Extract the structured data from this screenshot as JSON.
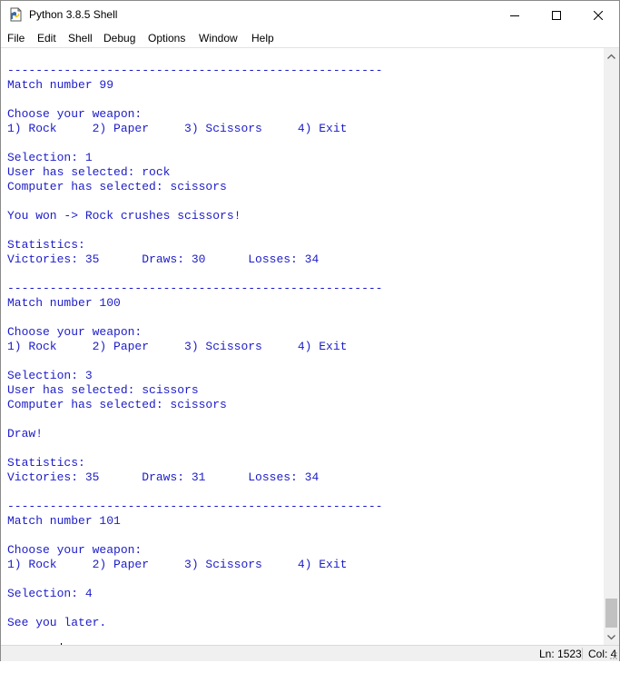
{
  "window": {
    "title": "Python 3.8.5 Shell"
  },
  "menu": [
    "File",
    "Edit",
    "Shell",
    "Debug",
    "Options",
    "Window",
    "Help"
  ],
  "shell": {
    "lines": [
      "-----------------------------------------------------",
      "Match number 99",
      "",
      "Choose your weapon:",
      "1) Rock     2) Paper     3) Scissors     4) Exit",
      "",
      "Selection: 1",
      "User has selected: rock",
      "Computer has selected: scissors",
      "",
      "You won -> Rock crushes scissors!",
      "",
      "Statistics:",
      "Victories: 35      Draws: 30      Losses: 34",
      "",
      "-----------------------------------------------------",
      "Match number 100",
      "",
      "Choose your weapon:",
      "1) Rock     2) Paper     3) Scissors     4) Exit",
      "",
      "Selection: 3",
      "User has selected: scissors",
      "Computer has selected: scissors",
      "",
      "Draw!",
      "",
      "Statistics:",
      "Victories: 35      Draws: 31      Losses: 34",
      "",
      "-----------------------------------------------------",
      "Match number 101",
      "",
      "Choose your weapon:",
      "1) Rock     2) Paper     3) Scissors     4) Exit",
      "",
      "Selection: 4",
      "",
      "See you later."
    ],
    "prompt": ">>>"
  },
  "status": {
    "line": "Ln: 1523",
    "column": "Col: 4"
  },
  "colors": {
    "stdout": "#1c1cc9",
    "prompt": "#a31515"
  }
}
